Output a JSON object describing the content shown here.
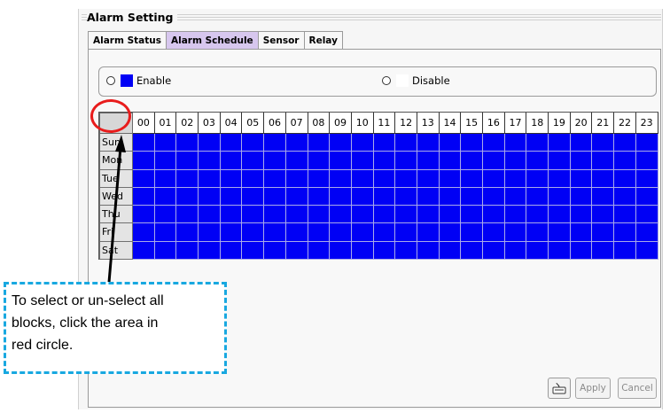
{
  "window": {
    "title": "Alarm Setting"
  },
  "tabs": [
    {
      "label": "Alarm Status",
      "active": false
    },
    {
      "label": "Alarm Schedule",
      "active": true
    },
    {
      "label": "Sensor",
      "active": false
    },
    {
      "label": "Relay",
      "active": false
    }
  ],
  "mode": {
    "enable_label": "Enable",
    "disable_label": "Disable",
    "enable_color": "#0000f5",
    "disable_color": "#ffffff"
  },
  "schedule": {
    "hours": [
      "00",
      "01",
      "02",
      "03",
      "04",
      "05",
      "06",
      "07",
      "08",
      "09",
      "10",
      "11",
      "12",
      "13",
      "14",
      "15",
      "16",
      "17",
      "18",
      "19",
      "20",
      "21",
      "22",
      "23"
    ],
    "days": [
      "Sun",
      "Mon",
      "Tue",
      "Wed",
      "Thu",
      "Fri",
      "Sat"
    ],
    "all_enabled": true
  },
  "annotation": {
    "text_lines": [
      "To select or un-select all",
      "blocks, click the area in",
      "red circle."
    ],
    "circle_color": "#e81c1c",
    "callout_border_color": "#18a8e0"
  },
  "buttons": {
    "apply_label": "Apply",
    "cancel_label": "Cancel",
    "keyboard_icon": "keyboard-icon"
  }
}
